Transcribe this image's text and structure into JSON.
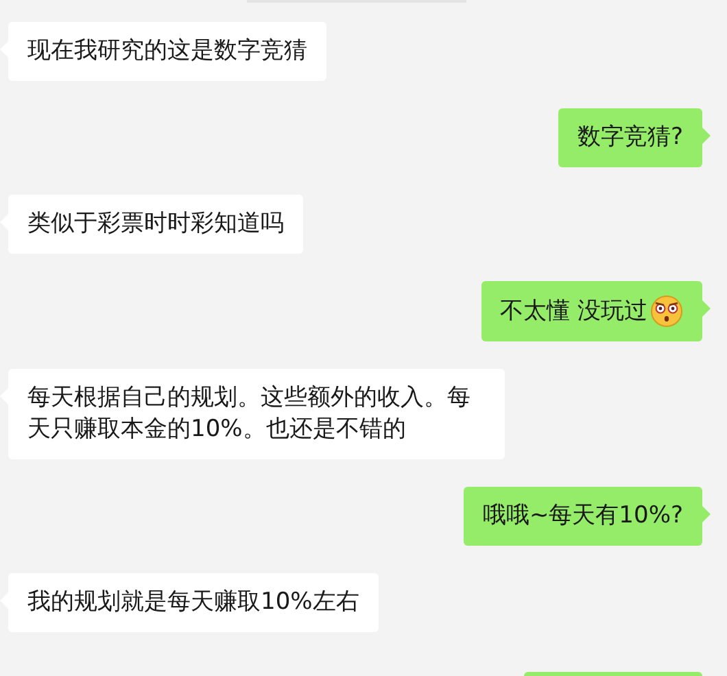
{
  "messages": [
    {
      "kind": "received",
      "text": "现在我研究的这是数字竞猜"
    },
    {
      "kind": "sent",
      "text": "数字竞猜?"
    },
    {
      "kind": "received",
      "text": "类似于彩票时时彩知道吗"
    },
    {
      "kind": "sent",
      "text": "不太懂 没玩过",
      "emoji": true
    },
    {
      "kind": "received",
      "text": "每天根据自己的规划。这些额外的收入。每天只赚取本金的10%。也还是不错的"
    },
    {
      "kind": "sent",
      "text": "哦哦~每天有10%?"
    },
    {
      "kind": "received",
      "text": "我的规划就是每天赚取10%左右"
    }
  ]
}
